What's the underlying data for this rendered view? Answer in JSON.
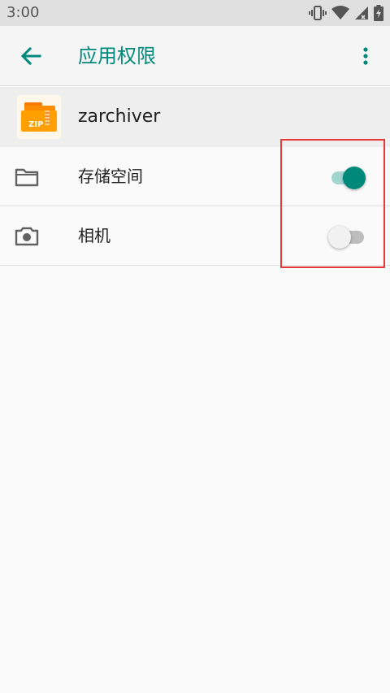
{
  "status_bar": {
    "time": "3:00",
    "icons": [
      "vibrate-icon",
      "wifi-icon",
      "signal-icon",
      "battery-charging-icon"
    ]
  },
  "appbar": {
    "title": "应用权限",
    "back_icon": "arrow-back-icon",
    "more_icon": "more-vert-icon"
  },
  "app": {
    "name": "zarchiver",
    "icon": "zip-folder-icon",
    "icon_text": "ZIP"
  },
  "permissions": [
    {
      "label": "存储空间",
      "icon": "folder-icon",
      "enabled": true
    },
    {
      "label": "相机",
      "icon": "camera-icon",
      "enabled": false
    }
  ],
  "colors": {
    "accent": "#00897b",
    "switch_on_track": "#a3d5cf",
    "highlight": "#e53935"
  }
}
